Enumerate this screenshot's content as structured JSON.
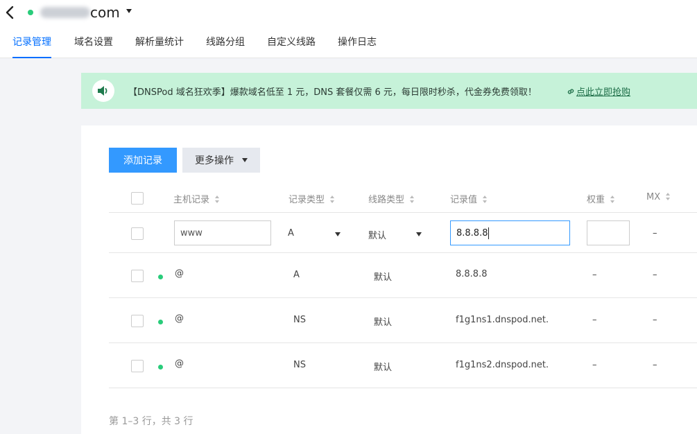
{
  "header": {
    "domain_suffix": "com",
    "tabs": [
      {
        "label": "记录管理",
        "active": true
      },
      {
        "label": "域名设置"
      },
      {
        "label": "解析量统计"
      },
      {
        "label": "线路分组"
      },
      {
        "label": "自定义线路"
      },
      {
        "label": "操作日志"
      }
    ]
  },
  "banner": {
    "text": "【DNSPod 域名狂欢季】爆款域名低至 1 元，DNS 套餐仅需 6 元，每日限时秒杀，代金券免费领取！",
    "link_label": "点此立即抢购"
  },
  "toolbar": {
    "add_label": "添加记录",
    "more_label": "更多操作"
  },
  "table": {
    "headers": {
      "host": "主机记录",
      "type": "记录类型",
      "line": "线路类型",
      "value": "记录值",
      "weight": "权重",
      "mx": "MX"
    },
    "edit_row": {
      "host": "www",
      "type": "A",
      "line": "默认",
      "value": "8.8.8.8",
      "weight": "",
      "mx": "–"
    },
    "rows": [
      {
        "host": "@",
        "type": "A",
        "line": "默认",
        "value": "8.8.8.8",
        "weight": "–",
        "mx": "–"
      },
      {
        "host": "@",
        "type": "NS",
        "line": "默认",
        "value": "f1g1ns1.dnspod.net.",
        "weight": "–",
        "mx": "–"
      },
      {
        "host": "@",
        "type": "NS",
        "line": "默认",
        "value": "f1g1ns2.dnspod.net.",
        "weight": "–",
        "mx": "–"
      }
    ]
  },
  "footer": {
    "summary": "第 1–3 行，共 3 行"
  },
  "colors": {
    "accent": "#006eff",
    "primary_button": "#3399ff",
    "banner_bg": "#c6f2d9",
    "status_green": "#29cc7a"
  }
}
